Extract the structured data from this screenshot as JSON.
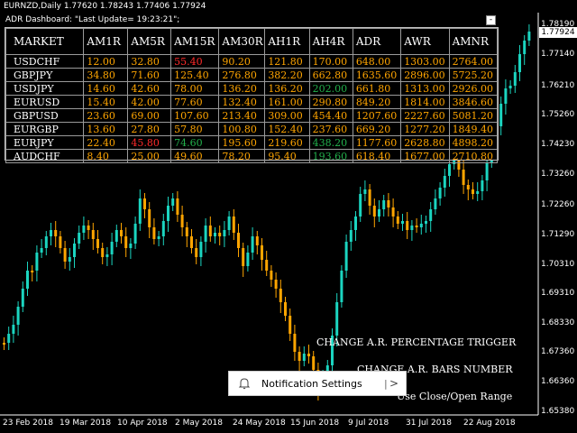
{
  "chart": {
    "header": "EURNZD,Daily  1.77620 1.78243 1.77406 1.77924",
    "current_price": "1.77924",
    "price_axis": [
      "1.78190",
      "1.77140",
      "1.76210",
      "1.75260",
      "1.74230",
      "1.73260",
      "1.72260",
      "1.71290",
      "1.70310",
      "1.69310",
      "1.68330",
      "1.67360",
      "1.66360",
      "1.65380"
    ],
    "date_axis": [
      "23 Feb 2018",
      "19 Mar 2018",
      "10 Apr 2018",
      "2 May 2018",
      "24 May 2018",
      "15 Jun 2018",
      "9 Jul 2018",
      "31 Jul 2018",
      "22 Aug 2018"
    ],
    "colors": {
      "bull": "#1bd5c0",
      "bear": "#ffa500",
      "background": "#000000"
    }
  },
  "dashboard": {
    "title": "ADR Dashboard: \"Last Update= 19:23:21\";",
    "close_label": "-",
    "columns": [
      "MARKET",
      "AM1R",
      "AM5R",
      "AM15R",
      "AM30R",
      "AH1R",
      "AH4R",
      "ADR",
      "AWR",
      "AMNR"
    ],
    "rows": [
      {
        "symbol": "USDCHF",
        "values": [
          "12.00",
          "32.80",
          "55.40",
          "90.20",
          "121.80",
          "170.00",
          "648.00",
          "1303.00",
          "2764.00"
        ]
      },
      {
        "symbol": "GBPJPY",
        "values": [
          "34.80",
          "71.60",
          "125.40",
          "276.80",
          "382.20",
          "662.80",
          "1635.60",
          "2896.00",
          "5725.20"
        ]
      },
      {
        "symbol": "USDJPY",
        "values": [
          "14.60",
          "42.60",
          "78.00",
          "136.20",
          "136.20",
          "202.00",
          "661.80",
          "1313.00",
          "2926.00"
        ]
      },
      {
        "symbol": "EURUSD",
        "values": [
          "15.40",
          "42.00",
          "77.60",
          "132.40",
          "161.00",
          "290.80",
          "849.20",
          "1814.00",
          "3846.60"
        ]
      },
      {
        "symbol": "GBPUSD",
        "values": [
          "23.60",
          "69.00",
          "107.60",
          "213.40",
          "309.00",
          "454.40",
          "1207.60",
          "2227.60",
          "5081.20"
        ]
      },
      {
        "symbol": "EURGBP",
        "values": [
          "13.60",
          "27.80",
          "57.80",
          "100.80",
          "152.40",
          "237.60",
          "669.20",
          "1277.20",
          "1849.40"
        ]
      },
      {
        "symbol": "EURJPY",
        "values": [
          "22.40",
          "45.80",
          "74.60",
          "195.60",
          "219.60",
          "438.20",
          "1177.60",
          "2628.80",
          "4898.20"
        ]
      },
      {
        "symbol": "AUDCHF",
        "values": [
          "8.40",
          "25.00",
          "49.60",
          "78.20",
          "95.40",
          "193.60",
          "618.40",
          "1677.00",
          "2710.80"
        ]
      }
    ],
    "value_colors": [
      [
        "#ffa500",
        "#ffa500",
        "#ff2a2a",
        "#ffa500",
        "#ffa500",
        "#ffa500",
        "#ffa500",
        "#ffa500",
        "#ffa500"
      ],
      [
        "#ffa500",
        "#ffa500",
        "#ffa500",
        "#ffa500",
        "#ffa500",
        "#ffa500",
        "#ffa500",
        "#ffa500",
        "#ffa500"
      ],
      [
        "#ffa500",
        "#ffa500",
        "#ffa500",
        "#ffa500",
        "#ffa500",
        "#22b14c",
        "#ffa500",
        "#ffa500",
        "#ffa500"
      ],
      [
        "#ffa500",
        "#ffa500",
        "#ffa500",
        "#ffa500",
        "#ffa500",
        "#ffa500",
        "#ffa500",
        "#ffa500",
        "#ffa500"
      ],
      [
        "#ffa500",
        "#ffa500",
        "#ffa500",
        "#ffa500",
        "#ffa500",
        "#ffa500",
        "#ffa500",
        "#ffa500",
        "#ffa500"
      ],
      [
        "#ffa500",
        "#ffa500",
        "#ffa500",
        "#ffa500",
        "#ffa500",
        "#ffa500",
        "#ffa500",
        "#ffa500",
        "#ffa500"
      ],
      [
        "#ffa500",
        "#ff2a2a",
        "#22b14c",
        "#ffa500",
        "#ffa500",
        "#22b14c",
        "#ffa500",
        "#ffa500",
        "#ffa500"
      ],
      [
        "#ffa500",
        "#ffa500",
        "#ffa500",
        "#ffa500",
        "#ffa500",
        "#22b14c",
        "#ffa500",
        "#ffa500",
        "#ffa500"
      ]
    ]
  },
  "controls": {
    "change_ar_percentage": "CHANGE A.R. PERCENTAGE TRIGGER",
    "change_ar_bars": "CHANGE A.R. BARS NUMBER",
    "use_close_open": "Use Close/Open Range"
  },
  "notification": {
    "label": "Notification Settings",
    "separator": "|",
    "chevron": ">"
  }
}
